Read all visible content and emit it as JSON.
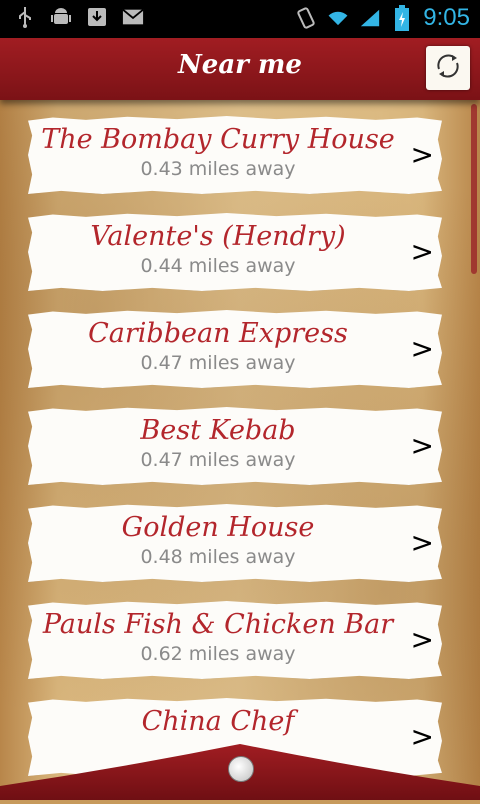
{
  "status_bar": {
    "time": "9:05",
    "left_icons": [
      "usb-icon",
      "android-icon",
      "download-icon",
      "gmail-icon"
    ],
    "right_icons": [
      "vibrate-icon",
      "wifi-icon",
      "signal-icon",
      "battery-icon"
    ]
  },
  "header": {
    "title": "Near me",
    "refresh_icon": "refresh-icon"
  },
  "colors": {
    "header_red": "#8f171c",
    "name_red": "#b3262c",
    "distance_gray": "#8a8a8a",
    "time_blue": "#33b5e5"
  },
  "restaurants": [
    {
      "name": "The Bombay Curry House",
      "distance": "0.43 miles away"
    },
    {
      "name": "Valente's (Hendry)",
      "distance": "0.44 miles away"
    },
    {
      "name": "Caribbean Express",
      "distance": "0.47 miles away"
    },
    {
      "name": "Best Kebab",
      "distance": "0.47 miles away"
    },
    {
      "name": "Golden House",
      "distance": "0.48 miles away"
    },
    {
      "name": "Pauls Fish & Chicken Bar",
      "distance": "0.62 miles away"
    },
    {
      "name": "China Chef",
      "distance": ""
    }
  ],
  "chevron": ">"
}
